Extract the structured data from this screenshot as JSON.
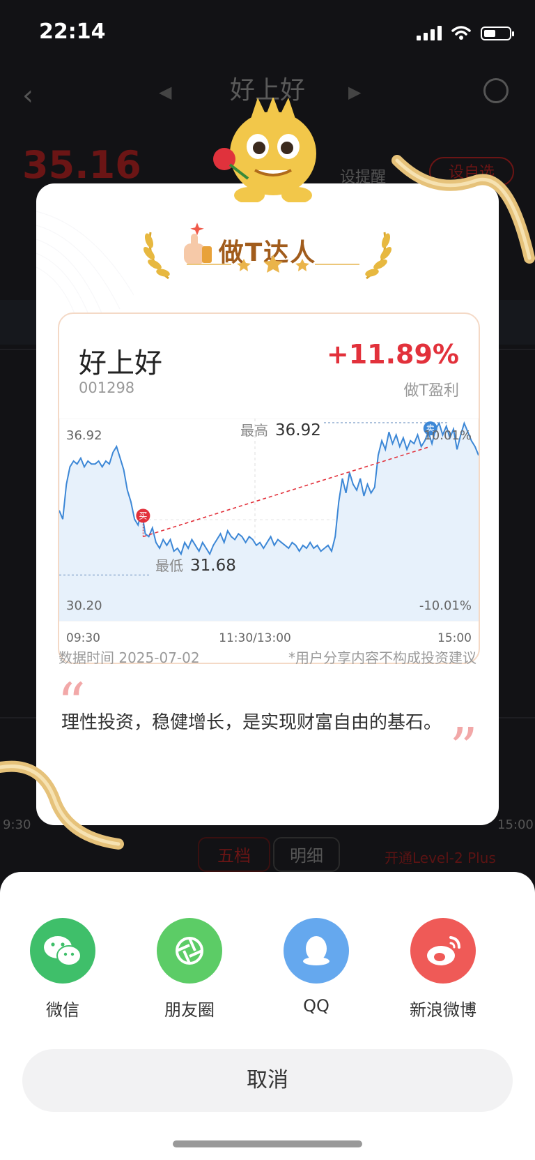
{
  "status_bar": {
    "time": "22:14"
  },
  "background": {
    "title": "好上好",
    "price": "35.16",
    "alert_label": "设提醒",
    "watch_label": "设自选",
    "tab_five": "五档",
    "tab_detail": "明细",
    "level2": "开通Level-2 Plus",
    "time_start": "9:30",
    "time_mid": "11:30/13:00",
    "time_end": "15:00"
  },
  "card": {
    "badge_title": "做T达人",
    "stock_name": "好上好",
    "stock_code": "001298",
    "gain": "+11.89%",
    "gain_label": "做T盈利",
    "data_time": "数据时间 2025-07-02",
    "disclaimer": "*用户分享内容不构成投资建议",
    "quote": "理性投资，稳健增长，是实现财富自由的基石。",
    "quote_open": "“",
    "quote_close": "”"
  },
  "chart_data": {
    "type": "line",
    "x_ticks": [
      "09:30",
      "11:30/13:00",
      "15:00"
    ],
    "ylim": [
      30.2,
      36.92
    ],
    "y_tick_left_top": "36.92",
    "y_tick_left_bottom": "30.20",
    "y_tick_right_top": "10.01%",
    "y_tick_right_bottom": "-10.01%",
    "high_label": "最高",
    "high_value": "36.92",
    "low_label": "最低",
    "low_value": "31.68",
    "buy_label": "买",
    "sell_label": "卖",
    "buy_point": {
      "t": 0.2,
      "price": 33.0
    },
    "sell_point": {
      "t": 0.885,
      "price": 36.1
    },
    "series": [
      {
        "values": [
          33.9,
          33.6,
          34.8,
          35.4,
          35.6,
          35.5,
          35.7,
          35.4,
          35.6,
          35.5,
          35.5,
          35.6,
          35.4,
          35.6,
          35.5,
          35.9,
          36.1,
          35.7,
          35.3,
          34.6,
          34.2,
          33.6,
          33.4,
          33.9,
          33.1,
          33.0,
          33.3,
          32.8,
          32.6,
          32.9,
          32.7,
          32.9,
          32.5,
          32.6,
          32.4,
          32.8,
          32.6,
          32.9,
          32.7,
          32.5,
          32.8,
          32.6,
          32.4,
          32.7,
          32.9,
          33.1,
          32.8,
          33.2,
          33.0,
          32.9,
          33.1,
          33.0,
          32.8,
          33.0,
          32.9,
          32.7,
          32.8,
          32.6,
          32.8,
          33.0,
          32.7,
          32.9,
          32.8,
          32.7,
          32.6,
          32.8,
          32.7,
          32.5,
          32.7,
          32.6,
          32.8,
          32.6,
          32.7,
          32.5,
          32.6,
          32.7,
          32.5,
          33.0,
          34.2,
          35.0,
          34.5,
          35.2,
          34.8,
          34.6,
          35.0,
          34.4,
          34.8,
          34.5,
          34.7,
          35.8,
          36.3,
          36.0,
          36.6,
          36.2,
          36.5,
          36.1,
          36.4,
          36.0,
          36.3,
          36.2,
          36.5,
          36.1,
          36.3,
          36.6,
          36.2,
          36.7,
          36.9,
          36.5,
          36.8,
          36.4,
          36.7,
          36.0,
          36.5,
          36.9,
          36.6,
          36.3,
          36.1,
          35.8
        ]
      }
    ]
  },
  "share_sheet": {
    "items": [
      {
        "label": "微信",
        "color": "#3fbf6a"
      },
      {
        "label": "朋友圈",
        "color": "#5ccc66"
      },
      {
        "label": "QQ",
        "color": "#65a8ee"
      },
      {
        "label": "新浪微博",
        "color": "#ef5a57"
      }
    ],
    "cancel": "取消"
  }
}
